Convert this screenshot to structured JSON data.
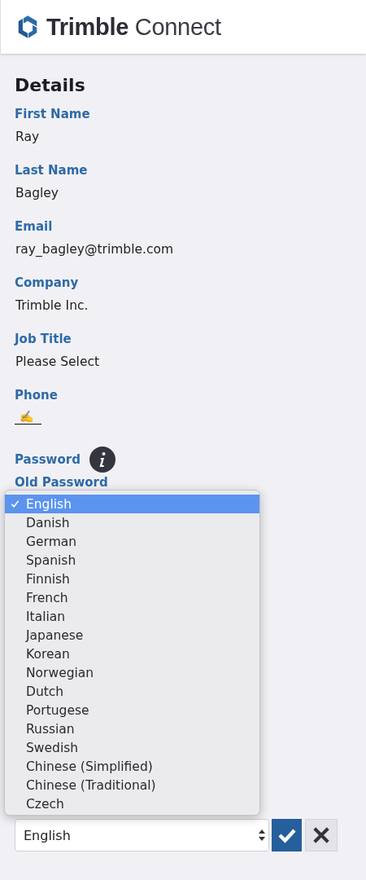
{
  "header": {
    "brand_bold": "Trimble",
    "brand_light": "Connect"
  },
  "section_title": "Details",
  "fields": [
    {
      "label": "First Name",
      "value": "Ray"
    },
    {
      "label": "Last Name",
      "value": "Bagley"
    },
    {
      "label": "Email",
      "value": "ray_bagley@trimble.com"
    },
    {
      "label": "Company",
      "value": "Trimble Inc."
    },
    {
      "label": "Job Title",
      "value": "Please Select"
    },
    {
      "label": "Phone",
      "value": "✍️"
    }
  ],
  "password": {
    "label": "Password",
    "old_label": "Old Password"
  },
  "language_menu": [
    {
      "label": "English",
      "selected": true
    },
    {
      "label": "Danish",
      "selected": false
    },
    {
      "label": "German",
      "selected": false
    },
    {
      "label": "Spanish",
      "selected": false
    },
    {
      "label": "Finnish",
      "selected": false
    },
    {
      "label": "French",
      "selected": false
    },
    {
      "label": "Italian",
      "selected": false
    },
    {
      "label": "Japanese",
      "selected": false
    },
    {
      "label": "Korean",
      "selected": false
    },
    {
      "label": "Norwegian",
      "selected": false
    },
    {
      "label": "Dutch",
      "selected": false
    },
    {
      "label": "Portugese",
      "selected": false
    },
    {
      "label": "Russian",
      "selected": false
    },
    {
      "label": "Swedish",
      "selected": false
    },
    {
      "label": "Chinese (Simplified)",
      "selected": false
    },
    {
      "label": "Chinese (Traditional)",
      "selected": false
    },
    {
      "label": "Czech",
      "selected": false
    }
  ],
  "language_select": {
    "value": "English"
  }
}
